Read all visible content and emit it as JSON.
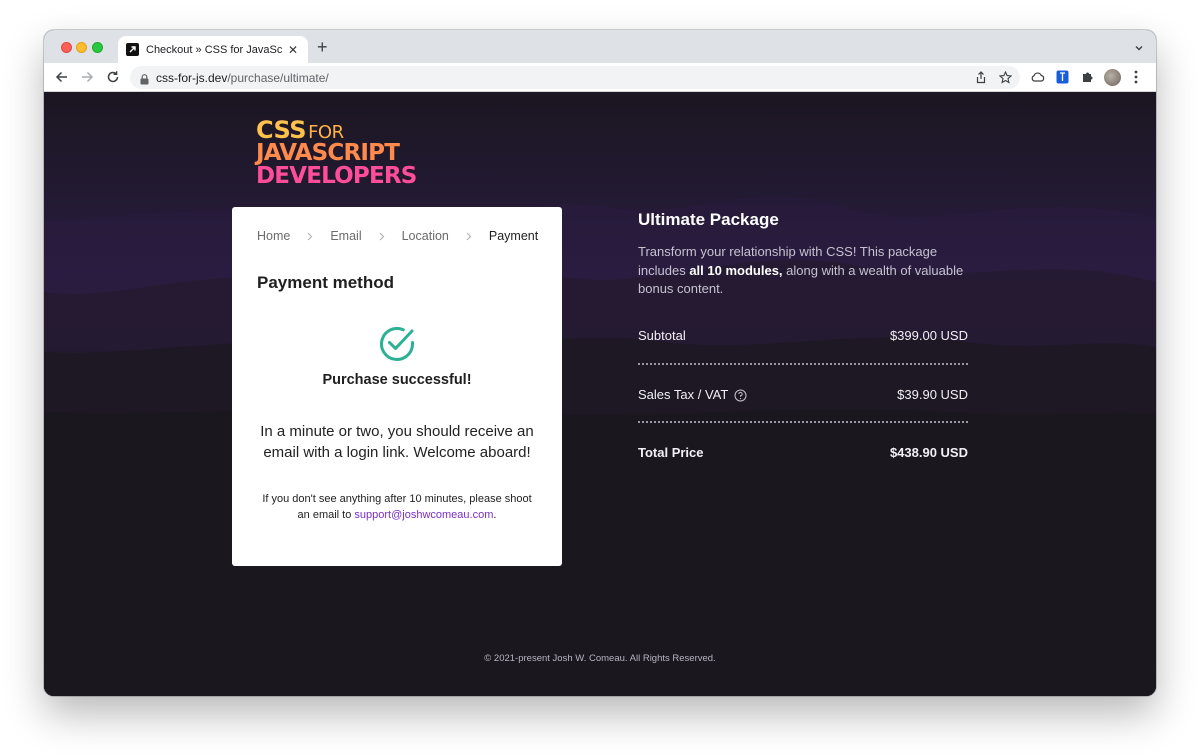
{
  "browser": {
    "tab_title": "Checkout » CSS for JavaScript",
    "url_domain": "css-for-js.dev",
    "url_path": "/purchase/ultimate/"
  },
  "logo": {
    "line1": "CSS",
    "line1_small": "FOR",
    "line2": "JAVASCRIPT",
    "line3": "DEVELOPERS"
  },
  "breadcrumbs": [
    {
      "label": "Home"
    },
    {
      "label": "Email"
    },
    {
      "label": "Location"
    },
    {
      "label": "Payment"
    }
  ],
  "card": {
    "title": "Payment method",
    "success_text": "Purchase successful!",
    "message": "In a minute or two, you should receive an email with a login link. Welcome aboard!",
    "note_prefix": "If you don't see anything after 10 minutes, please shoot an email to",
    "support_email": "support@joshwcomeau.com",
    "note_suffix": "."
  },
  "summary": {
    "title": "Ultimate Package",
    "desc_1": "Transform your relationship with CSS! This package includes",
    "desc_bold": "all 10 modules,",
    "desc_2": "along with a wealth of valuable bonus content.",
    "subtotal_label": "Subtotal",
    "subtotal_value": "$399.00 USD",
    "tax_label": "Sales Tax / VAT",
    "tax_value": "$39.90 USD",
    "total_label": "Total Price",
    "total_value": "$438.90 USD"
  },
  "footer": "© 2021-present Josh W. Comeau. All Rights Reserved.",
  "colors": {
    "accent_green": "#2bb193",
    "link_purple": "#7b2fc9",
    "page_bg": "#1a1620"
  }
}
